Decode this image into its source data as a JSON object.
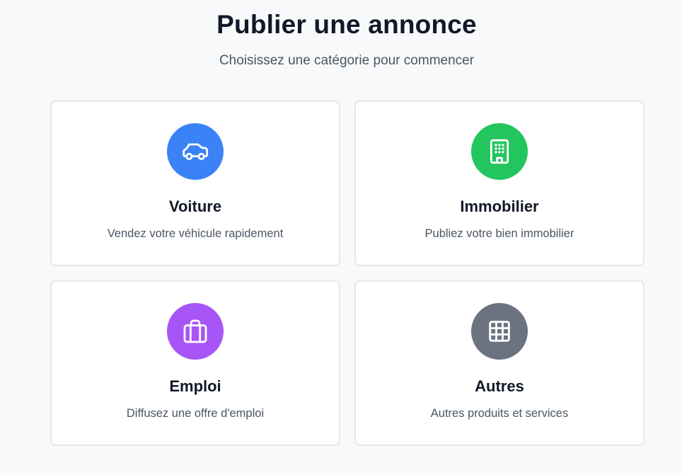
{
  "header": {
    "title": "Publier une annonce",
    "subtitle": "Choisissez une catégorie pour commencer"
  },
  "categories": [
    {
      "title": "Voiture",
      "description": "Vendez votre véhicule rapidement",
      "icon": "car-icon",
      "color": "#3b82f6"
    },
    {
      "title": "Immobilier",
      "description": "Publiez votre bien immobilier",
      "icon": "building-icon",
      "color": "#22c55e"
    },
    {
      "title": "Emploi",
      "description": "Diffusez une offre d'emploi",
      "icon": "briefcase-icon",
      "color": "#a855f7"
    },
    {
      "title": "Autres",
      "description": "Autres produits et services",
      "icon": "grid-icon",
      "color": "#6b7280"
    }
  ]
}
